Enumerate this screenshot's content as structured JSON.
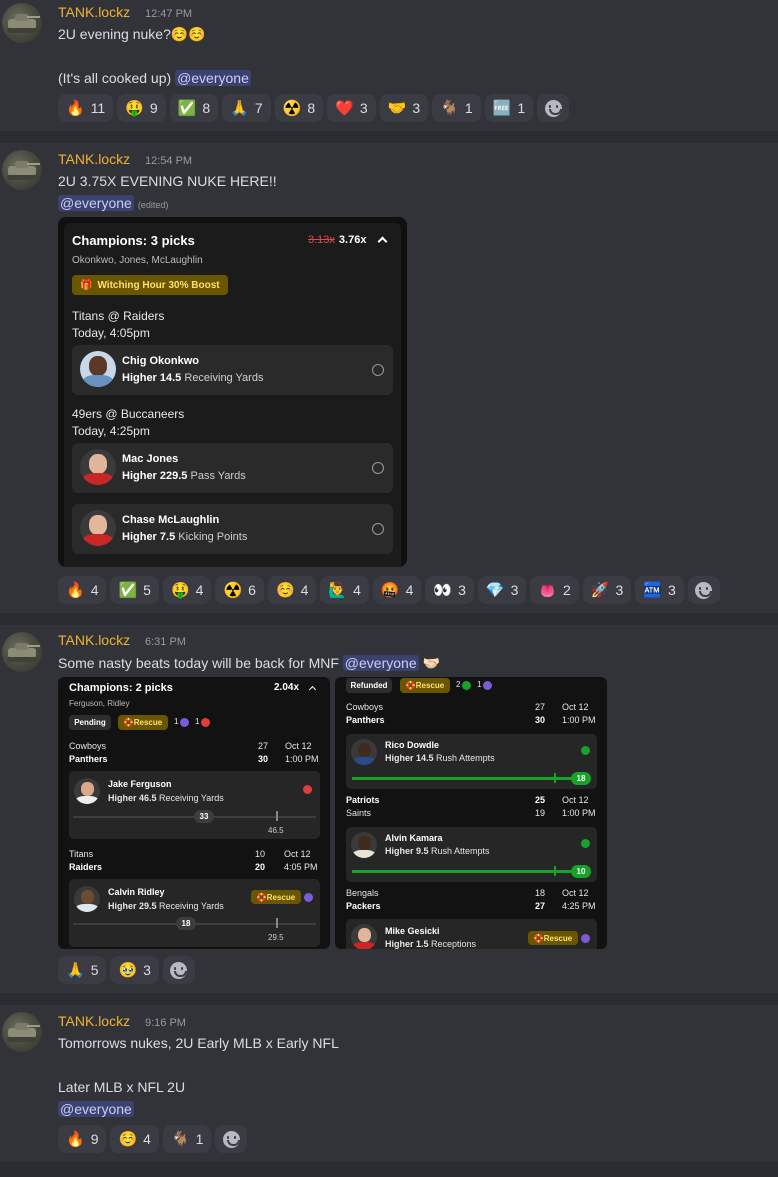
{
  "messages": [
    {
      "username": "TANK.lockz",
      "time": "12:47 PM",
      "line1": "2U evening nuke?☺️☺️",
      "line2": "(It's all cooked up) ",
      "mention": "@everyone",
      "reactions": [
        {
          "emoji": "🔥",
          "count": "11"
        },
        {
          "emoji": "🤑",
          "count": "9"
        },
        {
          "emoji": "✅",
          "count": "8"
        },
        {
          "emoji": "🙏",
          "count": "7"
        },
        {
          "emoji": "☢️",
          "count": "8"
        },
        {
          "emoji": "❤️",
          "count": "3"
        },
        {
          "emoji": "🤝",
          "count": "3"
        },
        {
          "emoji": "🐐",
          "count": "1"
        },
        {
          "emoji": "🆓",
          "count": "1"
        }
      ]
    },
    {
      "username": "TANK.lockz",
      "time": "12:54 PM",
      "line1": "2U 3.75X EVENING NUKE HERE!!",
      "mention": "@everyone",
      "edited": "(edited)",
      "reactions": [
        {
          "emoji": "🔥",
          "count": "4"
        },
        {
          "emoji": "✅",
          "count": "5"
        },
        {
          "emoji": "🤑",
          "count": "4"
        },
        {
          "emoji": "☢️",
          "count": "6"
        },
        {
          "emoji": "☺️",
          "count": "4"
        },
        {
          "emoji": "🙋‍♂️",
          "count": "4"
        },
        {
          "emoji": "🤬",
          "count": "4"
        },
        {
          "emoji": "👀",
          "count": "3"
        },
        {
          "emoji": "💎",
          "count": "3"
        },
        {
          "emoji": "👅",
          "count": "2"
        },
        {
          "emoji": "🚀",
          "count": "3"
        },
        {
          "emoji": "🏧",
          "count": "3"
        }
      ]
    },
    {
      "username": "TANK.lockz",
      "time": "6:31 PM",
      "line1": "Some nasty beats today will be back for MNF ",
      "mention": "@everyone",
      "trailing_emoji": "🤝🏻",
      "reactions": [
        {
          "emoji": "🙏",
          "count": "5"
        },
        {
          "emoji": "🥹",
          "count": "3"
        }
      ]
    },
    {
      "username": "TANK.lockz",
      "time": "9:16 PM",
      "line1": "Tomorrows nukes, 2U Early MLB x Early NFL",
      "line2": "Later MLB x NFL 2U",
      "mention": "@everyone",
      "reactions": [
        {
          "emoji": "🔥",
          "count": "9"
        },
        {
          "emoji": "☺️",
          "count": "4"
        },
        {
          "emoji": "🐐",
          "count": "1"
        }
      ]
    }
  ],
  "card1": {
    "title": "Champions: 3 picks",
    "old_mult": "3.13x",
    "new_mult": "3.76x",
    "players_line": "Okonkwo, Jones, McLaughlin",
    "boost": "Witching Hour 30% Boost",
    "games": [
      {
        "matchup": "Titans @ Raiders",
        "time": "Today, 4:05pm"
      },
      {
        "matchup": "49ers @ Buccaneers",
        "time": "Today, 4:25pm"
      }
    ],
    "picks": [
      {
        "name": "Chig Okonkwo",
        "dir": "Higher 14.5",
        "stat": "Receiving Yards"
      },
      {
        "name": "Mac Jones",
        "dir": "Higher 229.5",
        "stat": "Pass Yards"
      },
      {
        "name": "Chase McLaughlin",
        "dir": "Higher 7.5",
        "stat": "Kicking Points"
      }
    ]
  },
  "card2": {
    "left": {
      "title": "Champions: 2 picks",
      "mult": "2.04x",
      "players_line": "Ferguson, Ridley",
      "status": "Pending",
      "rescue": "Rescue",
      "rescue_count": "1",
      "loss_count": "1",
      "game1": {
        "away": "Cowboys",
        "home": "Panthers",
        "away_score": "27",
        "home_score": "30",
        "date": "Oct 12",
        "time": "1:00 PM"
      },
      "pick1": {
        "name": "Jake Ferguson",
        "dir": "Higher 46.5",
        "stat": "Receiving Yards",
        "actual": "33",
        "line": "46.5"
      },
      "game2": {
        "away": "Titans",
        "home": "Raiders",
        "away_score": "10",
        "home_score": "20",
        "date": "Oct 12",
        "time": "4:05 PM"
      },
      "pick2": {
        "name": "Calvin Ridley",
        "dir": "Higher 29.5",
        "stat": "Receiving Yards",
        "rescue": "Rescue",
        "actual": "18",
        "line": "29.5"
      }
    },
    "right": {
      "status": "Refunded",
      "rescue": "Rescue",
      "win_count": "2",
      "rescue_count": "1",
      "game1": {
        "away": "Cowboys",
        "home": "Panthers",
        "away_score": "27",
        "home_score": "30",
        "date": "Oct 12",
        "time": "1:00 PM"
      },
      "pick1": {
        "name": "Rico Dowdle",
        "dir": "Higher 14.5",
        "stat": "Rush Attempts",
        "actual": "18"
      },
      "game2": {
        "away": "Patriots",
        "home": "Saints",
        "away_score": "25",
        "home_score": "19",
        "date": "Oct 12",
        "time": "1:00 PM"
      },
      "pick2": {
        "name": "Alvin Kamara",
        "dir": "Higher 9.5",
        "stat": "Rush Attempts",
        "actual": "10"
      },
      "game3": {
        "away": "Bengals",
        "home": "Packers",
        "away_score": "18",
        "home_score": "27",
        "date": "Oct 12",
        "time": "4:25 PM"
      },
      "pick3": {
        "name": "Mike Gesicki",
        "dir": "Higher 1.5",
        "stat": "Receptions",
        "rescue": "Rescue"
      }
    }
  },
  "colors": {
    "username": "#f0b232",
    "mention_bg": "#3c4270",
    "win": "#17a32a",
    "loss": "#e03c3c",
    "boost_bg": "#6b5600"
  }
}
